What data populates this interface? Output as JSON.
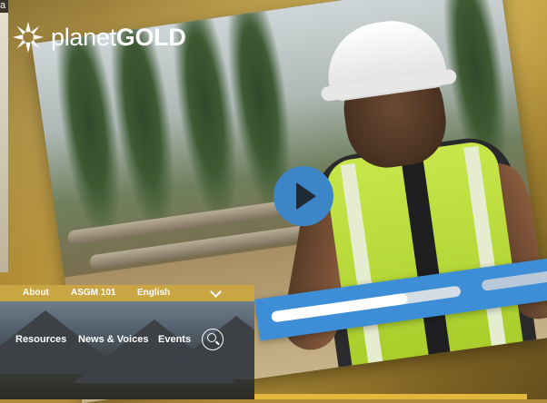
{
  "brand": {
    "name_light": "planet",
    "name_bold": "GOLD"
  },
  "corner_text": "a",
  "utility_nav": {
    "about": "About",
    "asgm": "ASGM 101",
    "language": "English"
  },
  "main_nav": {
    "resources": "Resources",
    "news": "News & Voices",
    "events": "Events"
  },
  "video": {
    "progress": 0.72
  },
  "colors": {
    "gold": "#c9a544",
    "play_blue": "#3c86c8",
    "band_blue": "#3d8ed6"
  },
  "icons": [
    "planetgold-logo-icon",
    "play-icon",
    "search-icon",
    "chevron-down-icon"
  ]
}
